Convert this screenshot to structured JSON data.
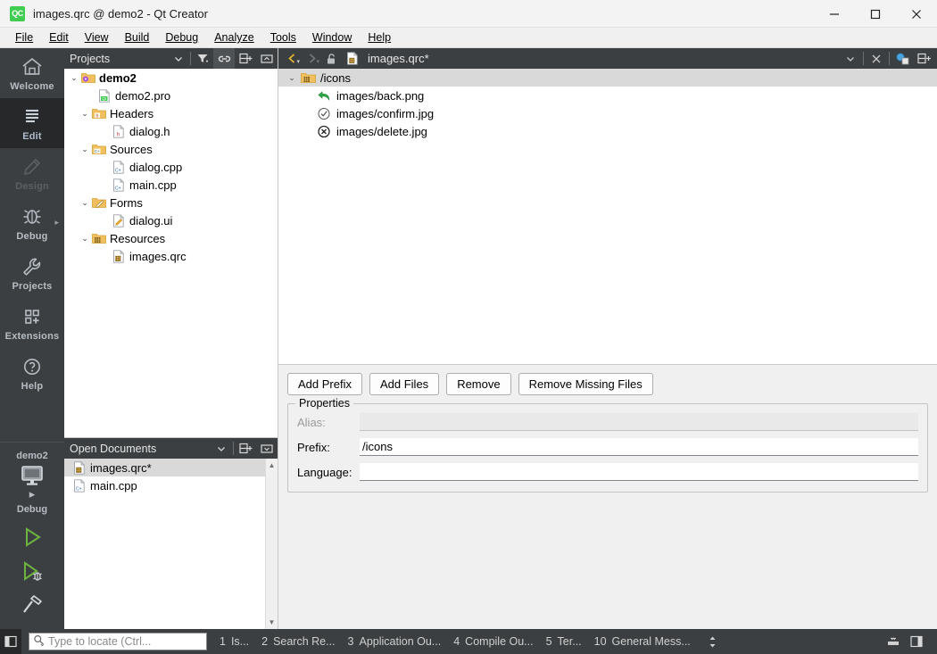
{
  "window": {
    "title": "images.qrc @ demo2 - Qt Creator",
    "logo_text": "QC",
    "controls": {
      "minimize": "minimize-icon",
      "maximize": "maximize-icon",
      "close": "close-icon"
    }
  },
  "menubar": {
    "items": [
      {
        "label": "File",
        "mnemonic": "F"
      },
      {
        "label": "Edit",
        "mnemonic": "E"
      },
      {
        "label": "View",
        "mnemonic": "V"
      },
      {
        "label": "Build",
        "mnemonic": "B"
      },
      {
        "label": "Debug",
        "mnemonic": "D"
      },
      {
        "label": "Analyze",
        "mnemonic": "A"
      },
      {
        "label": "Tools",
        "mnemonic": "T"
      },
      {
        "label": "Window",
        "mnemonic": "W"
      },
      {
        "label": "Help",
        "mnemonic": "H"
      }
    ]
  },
  "mode_selector": {
    "items": [
      {
        "label": "Welcome",
        "icon": "home-icon",
        "state": "normal"
      },
      {
        "label": "Edit",
        "icon": "edit-lines-icon",
        "state": "active"
      },
      {
        "label": "Design",
        "icon": "design-pen-icon",
        "state": "disabled"
      },
      {
        "label": "Debug",
        "icon": "debug-bug-icon",
        "state": "normal",
        "has_arrow": true
      },
      {
        "label": "Projects",
        "icon": "wrench-icon",
        "state": "normal"
      },
      {
        "label": "Extensions",
        "icon": "extensions-squares-icon",
        "state": "normal"
      },
      {
        "label": "Help",
        "icon": "help-question-icon",
        "state": "normal"
      }
    ],
    "kit": {
      "project": "demo2",
      "build_config": "Debug",
      "target_icon": "monitor-icon",
      "run_button": "run-play-icon",
      "debug_button": "debug-run-icon",
      "build_button": "build-hammer-icon"
    }
  },
  "projects_dock": {
    "title": "Projects",
    "toolbar": [
      {
        "name": "filter-icon",
        "selected": false
      },
      {
        "name": "link-sync-icon",
        "selected": true
      },
      {
        "name": "split-add-icon",
        "selected": false
      },
      {
        "name": "collapse-icon",
        "selected": false
      }
    ],
    "tree": [
      {
        "label": "demo2",
        "icon": "project-folder-icon",
        "depth": 0,
        "expanded": true,
        "bold": true
      },
      {
        "label": "demo2.pro",
        "icon": "qt-pro-file-icon",
        "depth": 1,
        "expanded": null,
        "bold": false
      },
      {
        "label": "Headers",
        "icon": "headers-folder-icon",
        "depth": 1,
        "expanded": true,
        "bold": false
      },
      {
        "label": "dialog.h",
        "icon": "header-file-icon",
        "depth": 2,
        "expanded": null,
        "bold": false
      },
      {
        "label": "Sources",
        "icon": "sources-folder-icon",
        "depth": 1,
        "expanded": true,
        "bold": false
      },
      {
        "label": "dialog.cpp",
        "icon": "cpp-file-icon",
        "depth": 2,
        "expanded": null,
        "bold": false
      },
      {
        "label": "main.cpp",
        "icon": "cpp-file-icon",
        "depth": 2,
        "expanded": null,
        "bold": false
      },
      {
        "label": "Forms",
        "icon": "forms-folder-icon",
        "depth": 1,
        "expanded": true,
        "bold": false
      },
      {
        "label": "dialog.ui",
        "icon": "ui-file-icon",
        "depth": 2,
        "expanded": null,
        "bold": false
      },
      {
        "label": "Resources",
        "icon": "resources-folder-icon",
        "depth": 1,
        "expanded": true,
        "bold": false
      },
      {
        "label": "images.qrc",
        "icon": "qrc-file-icon",
        "depth": 2,
        "expanded": null,
        "bold": false
      }
    ]
  },
  "open_documents_dock": {
    "title": "Open Documents",
    "toolbar": [
      {
        "name": "split-add-icon",
        "selected": false
      },
      {
        "name": "dropdown-box-icon",
        "selected": false
      }
    ],
    "items": [
      {
        "label": "images.qrc*",
        "icon": "qrc-file-icon",
        "selected": true
      },
      {
        "label": "main.cpp",
        "icon": "cpp-file-icon",
        "selected": false
      }
    ]
  },
  "editor_toolbar": {
    "back_icon": "navigate-back-icon",
    "forward_icon": "navigate-forward-icon",
    "lock_icon": "unlock-icon",
    "file_icon": "qrc-file-icon",
    "filename": "images.qrc*",
    "dropdown_icon": "chevron-down-icon",
    "close_icon": "close-icon",
    "split_left_icon": "split-editor-icon",
    "split_right_icon": "split-add-icon"
  },
  "resource_editor": {
    "tree": [
      {
        "label": "/icons",
        "icon": "prefix-folder-icon",
        "depth": 0,
        "expanded": true,
        "selected": true
      },
      {
        "label": "images/back.png",
        "icon": "back-arrow-green-icon",
        "depth": 1,
        "expanded": null,
        "selected": false
      },
      {
        "label": "images/confirm.jpg",
        "icon": "check-circle-icon",
        "depth": 1,
        "expanded": null,
        "selected": false
      },
      {
        "label": "images/delete.jpg",
        "icon": "x-circle-icon",
        "depth": 1,
        "expanded": null,
        "selected": false
      }
    ],
    "buttons": [
      {
        "label": "Add Prefix"
      },
      {
        "label": "Add Files"
      },
      {
        "label": "Remove"
      },
      {
        "label": "Remove Missing Files"
      }
    ],
    "properties": {
      "group_title": "Properties",
      "fields": [
        {
          "label": "Alias:",
          "value": "",
          "disabled": true
        },
        {
          "label": "Prefix:",
          "value": "/icons",
          "disabled": false
        },
        {
          "label": "Language:",
          "value": "",
          "disabled": false
        }
      ]
    }
  },
  "statusbar": {
    "sidebar_toggle_icon": "sidebar-toggle-icon",
    "locator_placeholder": "Type to locate (Ctrl...",
    "locator_icon": "search-icon",
    "panes": [
      {
        "num": "1",
        "label": "Is..."
      },
      {
        "num": "2",
        "label": "Search Re..."
      },
      {
        "num": "3",
        "label": "Application Ou..."
      },
      {
        "num": "4",
        "label": "Compile Ou..."
      },
      {
        "num": "5",
        "label": "Ter..."
      },
      {
        "num": "10",
        "label": "General Mess..."
      }
    ],
    "updown_icon": "updown-arrows-icon",
    "output_toggle_icon": "output-pane-toggle-icon",
    "right_sidebar_icon": "right-sidebar-toggle-icon"
  },
  "colors": {
    "dark_chrome": "#3b3f41",
    "dark_active": "#262829",
    "accent_green": "#41cd52",
    "selection_grey": "#d9d9d9",
    "folder_yellow": "#f5c242"
  }
}
